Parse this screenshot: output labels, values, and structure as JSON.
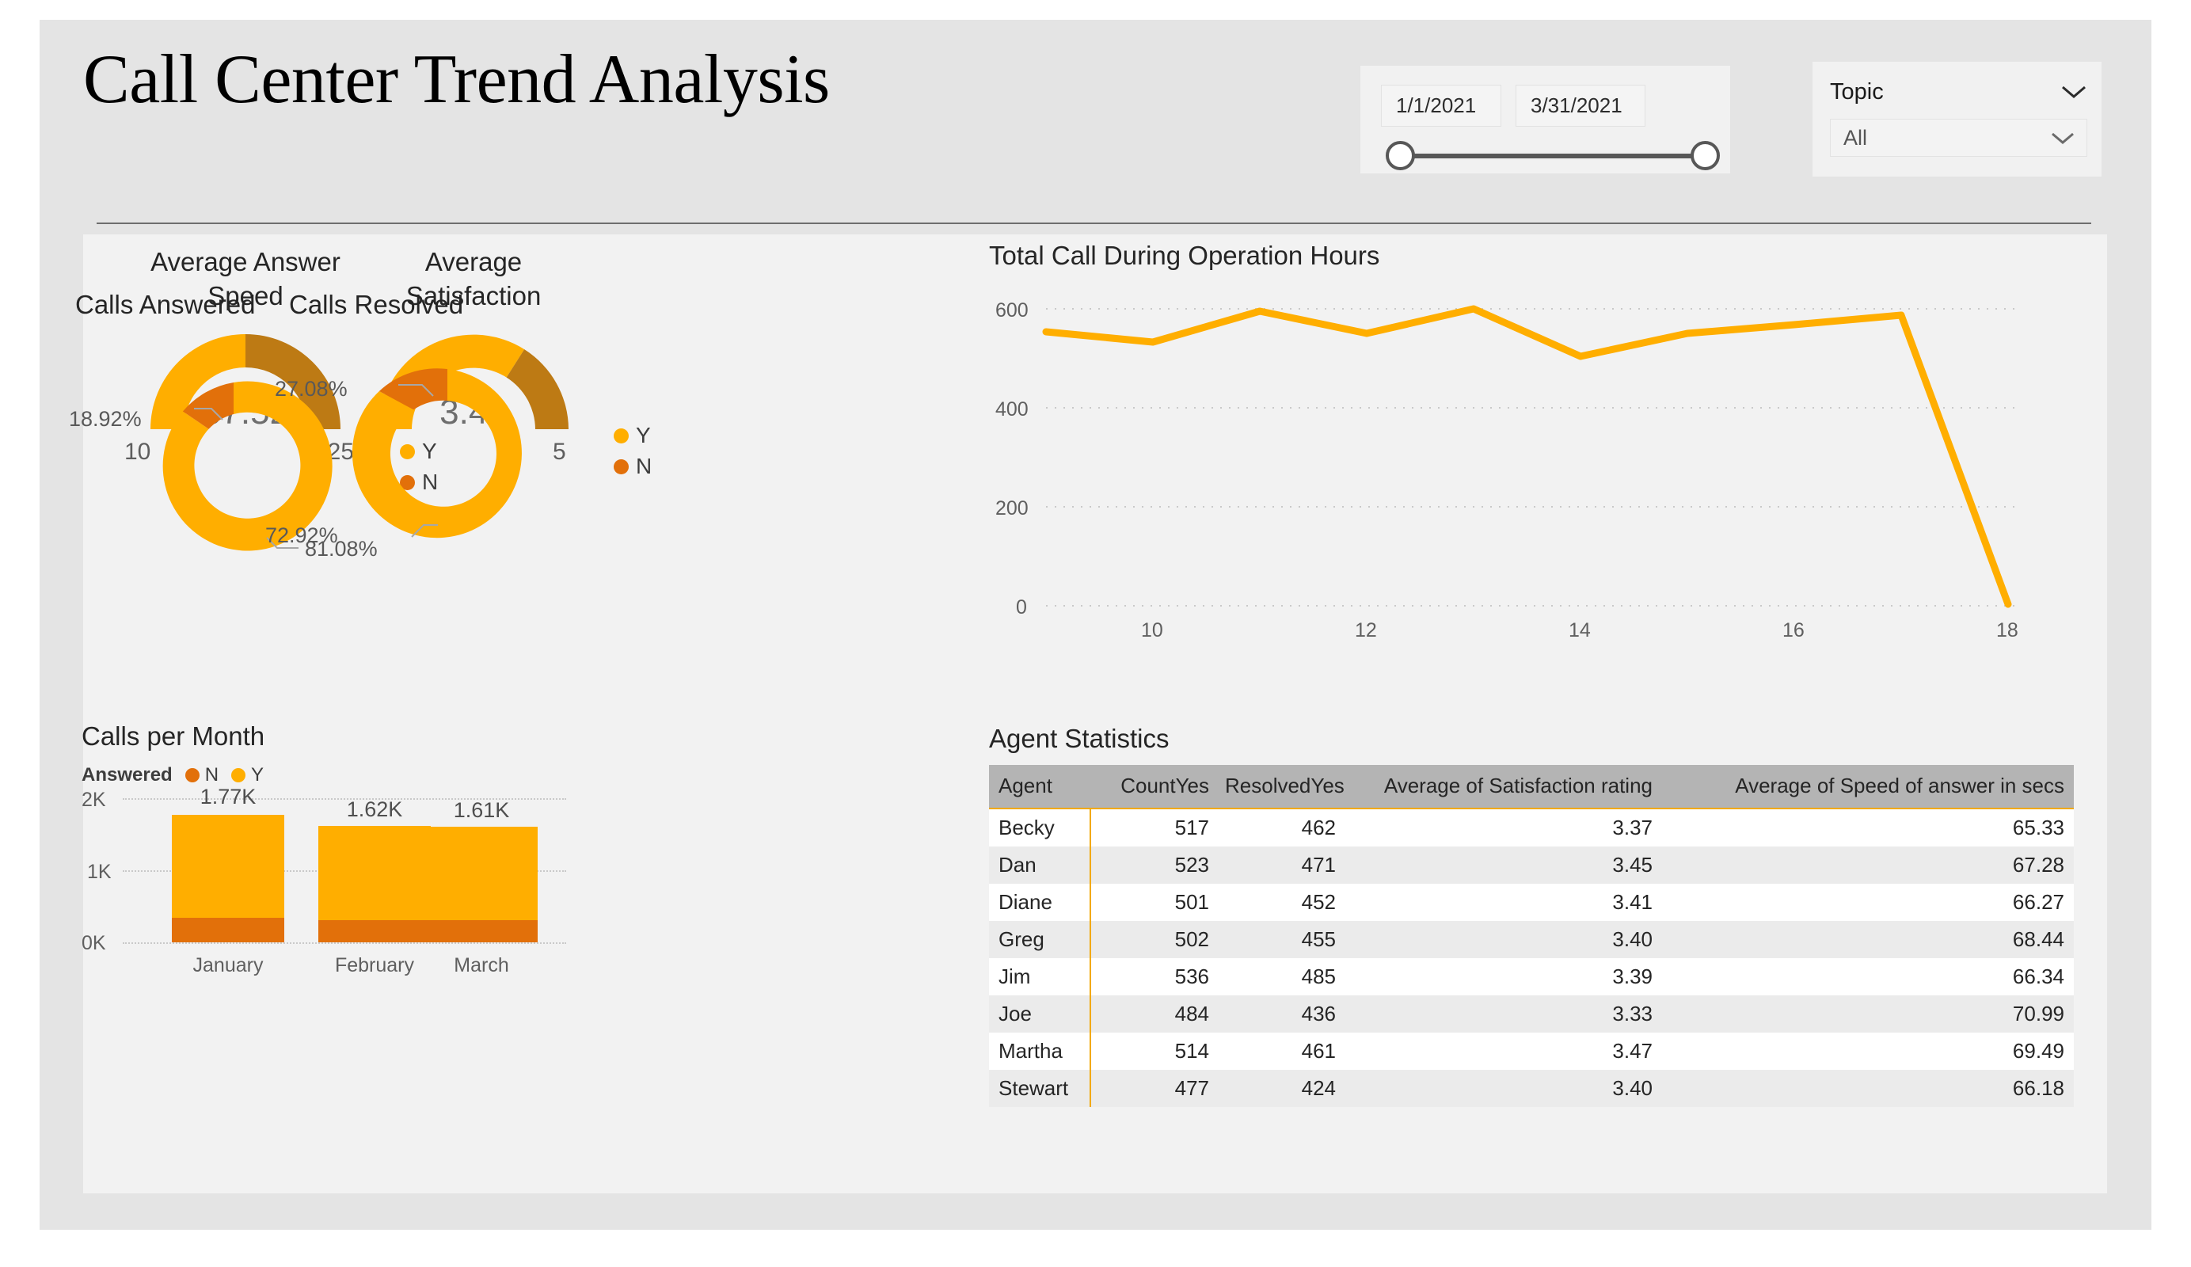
{
  "header": {
    "title": "Call Center Trend Analysis"
  },
  "date_slicer": {
    "name": "date-range-slicer",
    "start_date": "1/1/2021",
    "end_date": "3/31/2021",
    "handle_left_pos": 0,
    "handle_right_pos": 100
  },
  "topic_slicer": {
    "label": "Topic",
    "selected": "All",
    "expand_icon": "chevron-down-icon",
    "dropdown_icon": "chevron-down-icon"
  },
  "gauges": [
    {
      "title": "Average Answer Speed",
      "title_line1": "Average Answer",
      "title_line2": "Speed",
      "value": "67.52",
      "min": "10",
      "max": "125",
      "fill_fraction": 0.5002,
      "fill_color": "#FFAE00",
      "track_color": "#BD7A14"
    },
    {
      "title": "Average Satisfaction",
      "title_line1": "Average",
      "title_line2": "Satisfaction",
      "value": "3.40",
      "min": "0",
      "max": "5",
      "fill_fraction": 0.68,
      "fill_color": "#FFAE00",
      "track_color": "#BD7A14"
    }
  ],
  "donuts": [
    {
      "title": "Calls Answered",
      "legend": [
        {
          "label": "Y",
          "color": "#FFAE00"
        },
        {
          "label": "N",
          "color": "#E2700A"
        }
      ],
      "slices": [
        {
          "label": "Y",
          "percent": "81.08%",
          "value": 81.08,
          "color": "#FFAE00"
        },
        {
          "label": "N",
          "percent": "18.92%",
          "value": 18.92,
          "color": "#E2700A"
        }
      ]
    },
    {
      "title": "Calls Resolved",
      "legend": [
        {
          "label": "Y",
          "color": "#FFAE00"
        },
        {
          "label": "N",
          "color": "#E2700A"
        }
      ],
      "slices": [
        {
          "label": "Y",
          "percent": "72.92%",
          "value": 72.92,
          "color": "#FFAE00"
        },
        {
          "label": "N",
          "percent": "27.08%",
          "value": 27.08,
          "color": "#E2700A"
        }
      ]
    }
  ],
  "calls_per_month": {
    "title": "Calls per Month",
    "legend_title": "Answered",
    "legend": [
      {
        "label": "N",
        "color": "#E2700A"
      },
      {
        "label": "Y",
        "color": "#FFAE00"
      }
    ],
    "y_ticks": [
      "2K",
      "1K",
      "0K"
    ],
    "categories": [
      "January",
      "February",
      "March"
    ],
    "data_labels": [
      "1.77K",
      "1.62K",
      "1.61K"
    ]
  },
  "line_chart": {
    "title": "Total Call During Operation Hours",
    "y_ticks": [
      "600",
      "400",
      "200",
      "0"
    ],
    "x_ticks": [
      "10",
      "12",
      "14",
      "16",
      "18"
    ]
  },
  "agent_table": {
    "title": "Agent Statistics",
    "columns": [
      "Agent",
      "CountYes",
      "ResolvedYes",
      "Average of Satisfaction rating",
      "Average of Speed of answer in secs"
    ],
    "rows": [
      {
        "agent": "Becky",
        "count": "517",
        "resolved": "462",
        "satisfaction": "3.37",
        "speed": "65.33"
      },
      {
        "agent": "Dan",
        "count": "523",
        "resolved": "471",
        "satisfaction": "3.45",
        "speed": "67.28"
      },
      {
        "agent": "Diane",
        "count": "501",
        "resolved": "452",
        "satisfaction": "3.41",
        "speed": "66.27"
      },
      {
        "agent": "Greg",
        "count": "502",
        "resolved": "455",
        "satisfaction": "3.40",
        "speed": "68.44"
      },
      {
        "agent": "Jim",
        "count": "536",
        "resolved": "485",
        "satisfaction": "3.39",
        "speed": "66.34"
      },
      {
        "agent": "Joe",
        "count": "484",
        "resolved": "436",
        "satisfaction": "3.33",
        "speed": "70.99"
      },
      {
        "agent": "Martha",
        "count": "514",
        "resolved": "461",
        "satisfaction": "3.47",
        "speed": "69.49"
      },
      {
        "agent": "Stewart",
        "count": "477",
        "resolved": "424",
        "satisfaction": "3.40",
        "speed": "66.18"
      }
    ]
  },
  "chart_data": [
    {
      "type": "line",
      "title": "Total Call During Operation Hours",
      "xlabel": "",
      "ylabel": "",
      "x": [
        9,
        10,
        11,
        12,
        13,
        14,
        15,
        16,
        17,
        18
      ],
      "values": [
        555,
        533,
        597,
        551,
        600,
        504,
        551,
        570,
        588,
        3
      ],
      "xlim": [
        9,
        18
      ],
      "ylim": [
        0,
        600
      ],
      "xticks": [
        10,
        12,
        14,
        16,
        18
      ],
      "yticks": [
        0,
        200,
        400,
        600
      ],
      "grid": true,
      "legend": "none",
      "line_color": "#FFAE00"
    },
    {
      "type": "bar",
      "title": "Calls per Month",
      "stacked": true,
      "categories": [
        "January",
        "February",
        "March"
      ],
      "series": [
        {
          "name": "Y",
          "values": [
            1434,
            1313,
            1305
          ],
          "color": "#FFAE00"
        },
        {
          "name": "N",
          "values": [
            336,
            307,
            305
          ],
          "color": "#E2700A"
        }
      ],
      "totals": [
        1770,
        1620,
        1610
      ],
      "data_labels": [
        "1.77K",
        "1.62K",
        "1.61K"
      ],
      "ylim": [
        0,
        2000
      ],
      "yticks": [
        0,
        1000,
        2000
      ],
      "ytick_labels": [
        "0K",
        "1K",
        "2K"
      ],
      "grid": true,
      "legend": "top",
      "legend_title": "Answered"
    },
    {
      "type": "pie",
      "title": "Calls Answered",
      "labels": [
        "Y",
        "N"
      ],
      "values": [
        81.08,
        18.92
      ],
      "value_labels": [
        "81.08%",
        "18.92%"
      ],
      "colors": [
        "#FFAE00",
        "#E2700A"
      ],
      "donut": true,
      "legend": "right"
    },
    {
      "type": "pie",
      "title": "Calls Resolved",
      "labels": [
        "Y",
        "N"
      ],
      "values": [
        72.92,
        27.08
      ],
      "value_labels": [
        "72.92%",
        "27.08%"
      ],
      "colors": [
        "#FFAE00",
        "#E2700A"
      ],
      "donut": true,
      "legend": "right"
    },
    {
      "type": "gauge",
      "title": "Average Answer Speed",
      "value": 67.52,
      "min": 10,
      "max": 125,
      "colors": [
        "#FFAE00",
        "#BD7A14"
      ]
    },
    {
      "type": "gauge",
      "title": "Average Satisfaction",
      "value": 3.4,
      "min": 0,
      "max": 5,
      "colors": [
        "#FFAE00",
        "#BD7A14"
      ]
    },
    {
      "type": "table",
      "title": "Agent Statistics",
      "columns": [
        "Agent",
        "CountYes",
        "ResolvedYes",
        "Average of Satisfaction rating",
        "Average of Speed of answer in secs"
      ],
      "rows": [
        [
          "Becky",
          517,
          462,
          3.37,
          65.33
        ],
        [
          "Dan",
          523,
          471,
          3.45,
          67.28
        ],
        [
          "Diane",
          501,
          452,
          3.41,
          66.27
        ],
        [
          "Greg",
          502,
          455,
          3.4,
          68.44
        ],
        [
          "Jim",
          536,
          485,
          3.39,
          66.34
        ],
        [
          "Joe",
          484,
          436,
          3.33,
          70.99
        ],
        [
          "Martha",
          514,
          461,
          3.47,
          69.49
        ],
        [
          "Stewart",
          477,
          424,
          3.4,
          66.18
        ]
      ]
    }
  ]
}
